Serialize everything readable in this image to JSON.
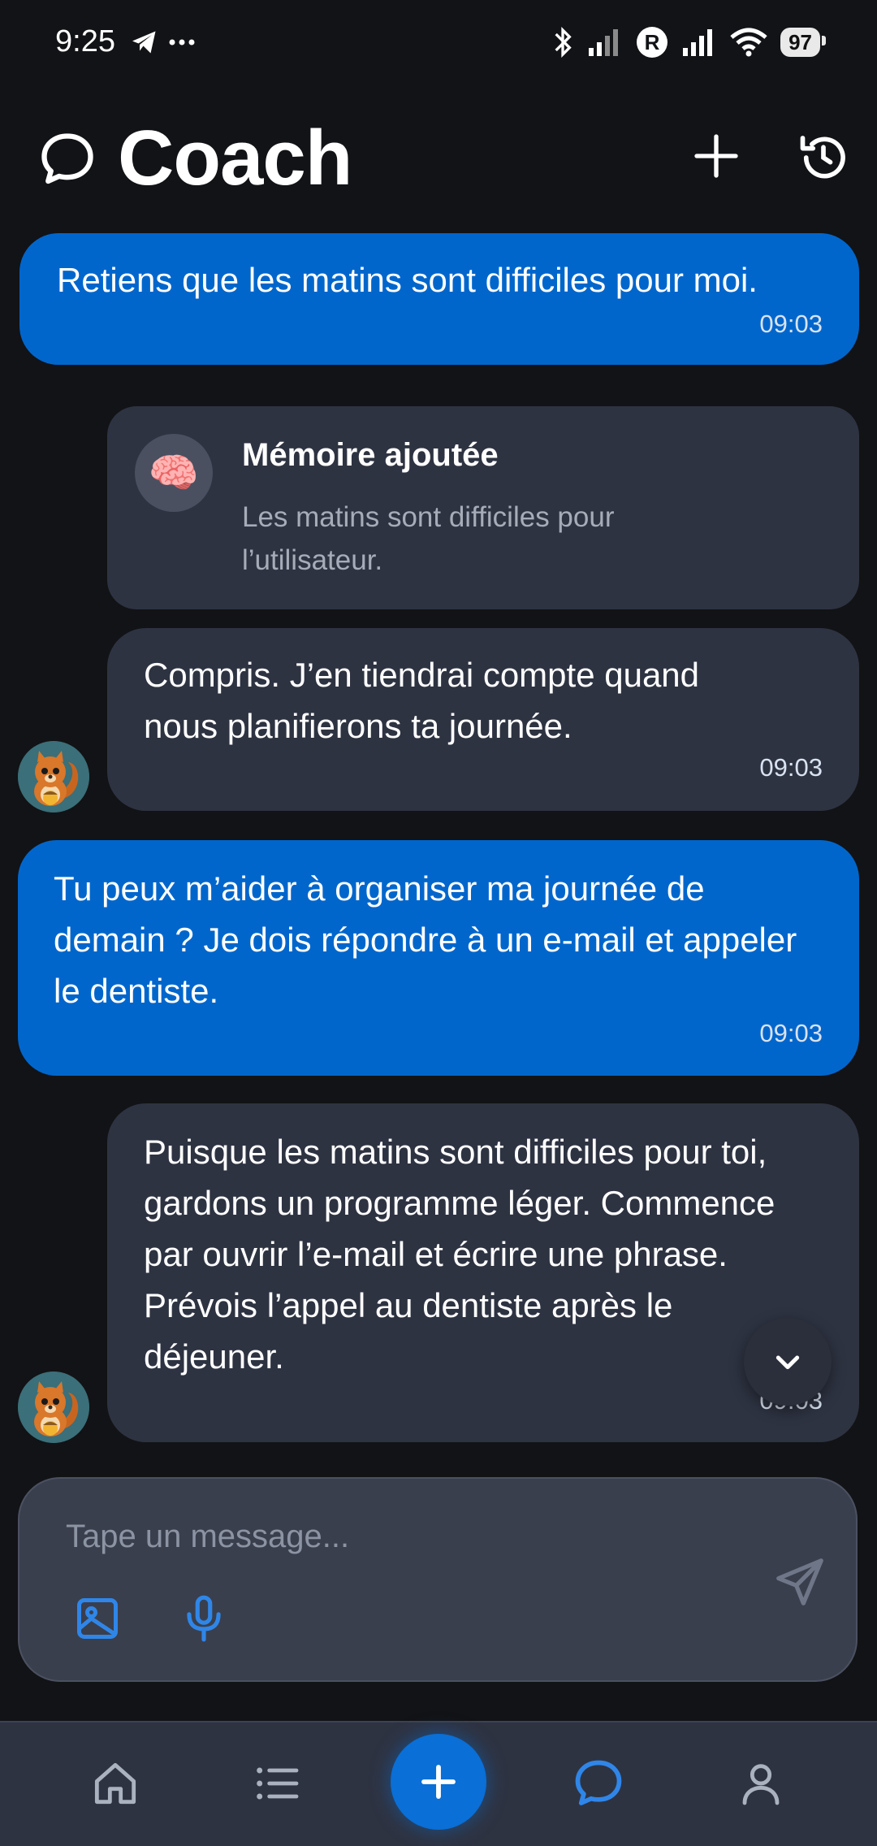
{
  "status_bar": {
    "time": "9:25",
    "battery": "97"
  },
  "header": {
    "title": "Coach",
    "icons": [
      "chat-bubble-icon",
      "plus-icon",
      "history-icon"
    ]
  },
  "messages": [
    {
      "role": "user",
      "text": "Retiens que les matins sont difficiles pour moi.",
      "time": "09:03"
    },
    {
      "role": "memory",
      "title": "Mémoire ajoutée",
      "text": "Les matins sont difficiles pour l’utilisateur.",
      "icon": "🧠"
    },
    {
      "role": "assistant",
      "text": "Compris. J’en tiendrai compte quand nous planifierons ta journée.",
      "time": "09:03"
    },
    {
      "role": "user",
      "text": "Tu peux m’aider à organiser ma journée de demain ? Je dois répondre à un e-mail et appeler le dentiste.",
      "time": "09:03"
    },
    {
      "role": "assistant",
      "text": "Puisque les matins sont difficiles pour toi, gardons un programme léger. Commence par ouvrir l’e-mail et écrire une phrase. Prévois l’appel au dentiste après le déjeuner.",
      "time": "09:03"
    }
  ],
  "composer": {
    "placeholder": "Tape un message..."
  },
  "nav": {
    "items": [
      "home-icon",
      "list-icon",
      "add-icon",
      "chat-icon",
      "profile-icon"
    ],
    "active": "chat-icon"
  },
  "colors": {
    "background": "#121316",
    "user_bubble": "#0066cc",
    "assistant_bubble": "#2e3342",
    "accent": "#0a6fd6"
  }
}
